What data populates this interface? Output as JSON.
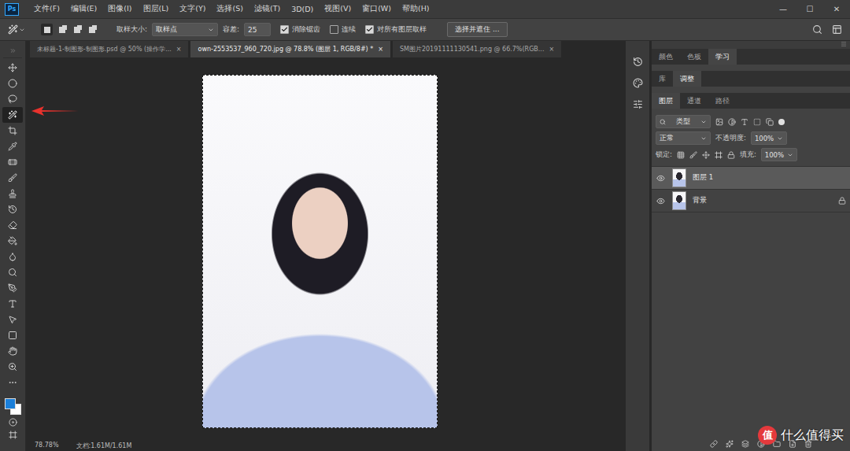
{
  "menu_bar": {
    "logo": "Ps",
    "items": [
      "文件(F)",
      "编辑(E)",
      "图像(I)",
      "图层(L)",
      "文字(Y)",
      "选择(S)",
      "滤镜(T)",
      "3D(D)",
      "视图(V)",
      "窗口(W)",
      "帮助(H)"
    ],
    "window_controls": [
      "—",
      "☐",
      "✕"
    ]
  },
  "options_bar": {
    "selection_modes": [
      {
        "selected": true
      },
      {
        "selected": false
      },
      {
        "selected": false
      },
      {
        "selected": false
      }
    ],
    "sample_size_label": "取样大小:",
    "sample_size": "取样点",
    "tolerance_label": "容差:",
    "tolerance": "25",
    "checkboxes": [
      {
        "label": "消除锯齿",
        "checked": true
      },
      {
        "label": "连续",
        "checked": false
      },
      {
        "label": "对所有图层取样",
        "checked": true
      }
    ],
    "select_mask_button": "选择并遮住 ..."
  },
  "doc_tabs": [
    {
      "label": "未标题-1-制图形-制图形.psd @ 50% (操作学...",
      "close": "×",
      "selected": false
    },
    {
      "label": "own-2553537_960_720.jpg @ 78.8% (图层 1, RGB/8#) *",
      "close": "×",
      "selected": true
    },
    {
      "label": "SM图片20191111130541.png @ 66.7%(RGB...",
      "close": "×",
      "selected": false
    }
  ],
  "tools": [
    {
      "selected": false
    },
    {
      "selected": false
    },
    {
      "selected": false
    },
    {
      "selected": true
    },
    {
      "selected": false
    },
    {
      "selected": false
    },
    {
      "selected": false
    },
    {
      "selected": false
    },
    {
      "selected": false
    },
    {
      "selected": false
    },
    {
      "selected": false
    },
    {
      "selected": false
    },
    {
      "selected": false
    },
    {
      "selected": false
    },
    {
      "selected": false
    },
    {
      "selected": false
    },
    {
      "selected": false
    },
    {
      "selected": false
    },
    {
      "selected": false
    },
    {
      "selected": false
    },
    {
      "selected": false
    }
  ],
  "colors": {
    "foreground": "#1b7fd9",
    "background": "#ffffff"
  },
  "status_bar": {
    "zoom": "78.78%",
    "doc_info": "文档:1.61M/1.61M"
  },
  "panel_groups": [
    {
      "tabs": [
        {
          "label": "颜色",
          "selected": false
        },
        {
          "label": "色板",
          "selected": false
        },
        {
          "label": "学习",
          "selected": true
        }
      ]
    },
    {
      "tabs": [
        {
          "label": "库",
          "selected": false
        },
        {
          "label": "调整",
          "selected": true
        }
      ]
    },
    {
      "tabs": [
        {
          "label": "图层",
          "selected": true
        },
        {
          "label": "通道",
          "selected": false
        },
        {
          "label": "路径",
          "selected": false
        }
      ]
    }
  ],
  "layers_panel": {
    "filter_kind": "类型",
    "blend_mode": "正常",
    "opacity_label": "不透明度:",
    "opacity": "100%",
    "lock_label": "锁定:",
    "fill_label": "填充:",
    "fill": "100%",
    "layers": [
      {
        "name": "图层 1",
        "selected": true,
        "visible": true,
        "locked": false
      },
      {
        "name": "背景",
        "selected": false,
        "visible": true,
        "locked": true
      }
    ]
  },
  "watermark": {
    "badge": "值",
    "text": "什么值得买"
  }
}
